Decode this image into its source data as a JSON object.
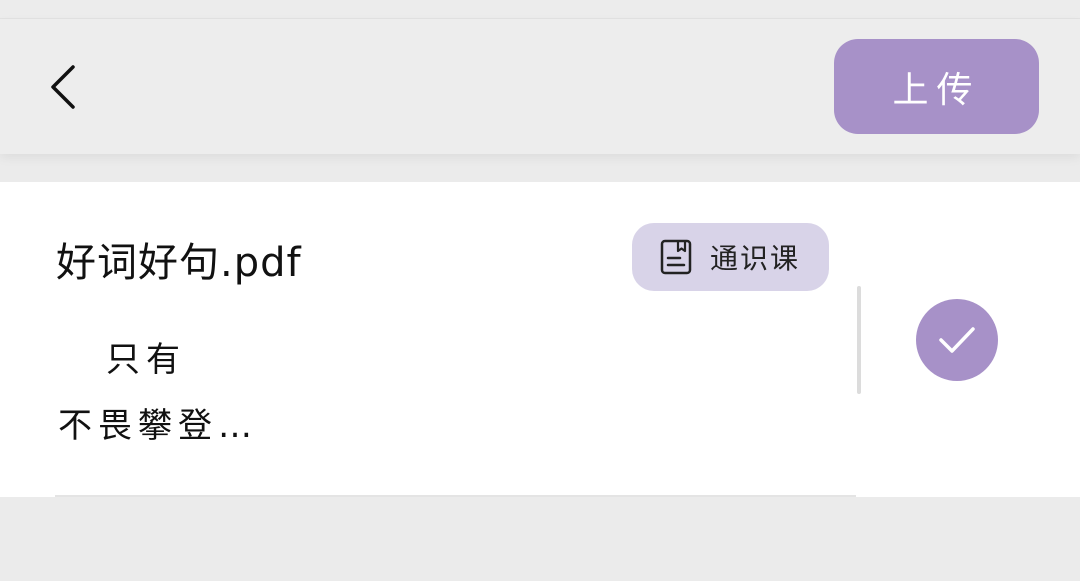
{
  "header": {
    "back_icon": "chevron-left-icon",
    "upload_label": "上传"
  },
  "file": {
    "name": "好词好句.pdf",
    "tag": {
      "icon": "document-icon",
      "label": "通识课"
    },
    "preview_line1": "只有",
    "preview_line2": "不畏攀登…",
    "selected": true,
    "select_icon": "checkmark-icon"
  },
  "colors": {
    "accent": "#a791c8",
    "tag_background": "#d8d3e8",
    "page_background": "#ebebeb",
    "card_background": "#ffffff"
  }
}
